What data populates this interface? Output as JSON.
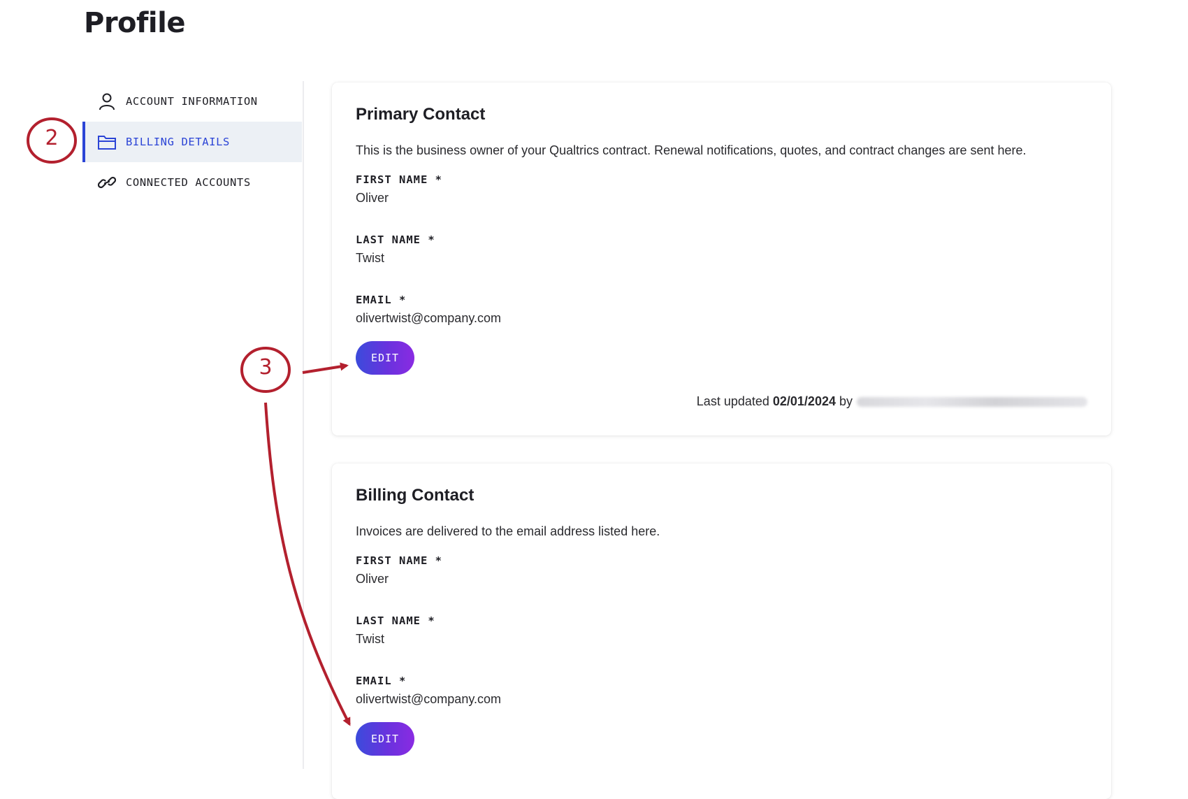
{
  "page": {
    "title": "Profile"
  },
  "sidebar": {
    "items": [
      {
        "label": "ACCOUNT INFORMATION",
        "icon": "user-icon",
        "active": false
      },
      {
        "label": "BILLING DETAILS",
        "icon": "folder-icon",
        "active": true
      },
      {
        "label": "CONNECTED ACCOUNTS",
        "icon": "link-icon",
        "active": false
      }
    ]
  },
  "primary": {
    "title": "Primary Contact",
    "description": "This is the business owner of your Qualtrics contract. Renewal notifications, quotes, and contract changes are sent here.",
    "first_name_label": "FIRST NAME *",
    "first_name": "Oliver",
    "last_name_label": "LAST NAME *",
    "last_name": "Twist",
    "email_label": "EMAIL *",
    "email": "olivertwist@company.com",
    "edit_label": "EDIT",
    "last_updated_prefix": "Last updated",
    "last_updated_date": "02/01/2024",
    "last_updated_by": "by"
  },
  "billing": {
    "title": "Billing Contact",
    "description": "Invoices are delivered to the email address listed here.",
    "first_name_label": "FIRST NAME *",
    "first_name": "Oliver",
    "last_name_label": "LAST NAME *",
    "last_name": "Twist",
    "email_label": "EMAIL *",
    "email": "olivertwist@company.com",
    "edit_label": "EDIT"
  },
  "annotations": {
    "step2": "2",
    "step3": "3"
  },
  "colors": {
    "accent": "#2b44d6",
    "annotation": "#b3202e",
    "button_start": "#3b4bdb",
    "button_end": "#8a2be2"
  }
}
